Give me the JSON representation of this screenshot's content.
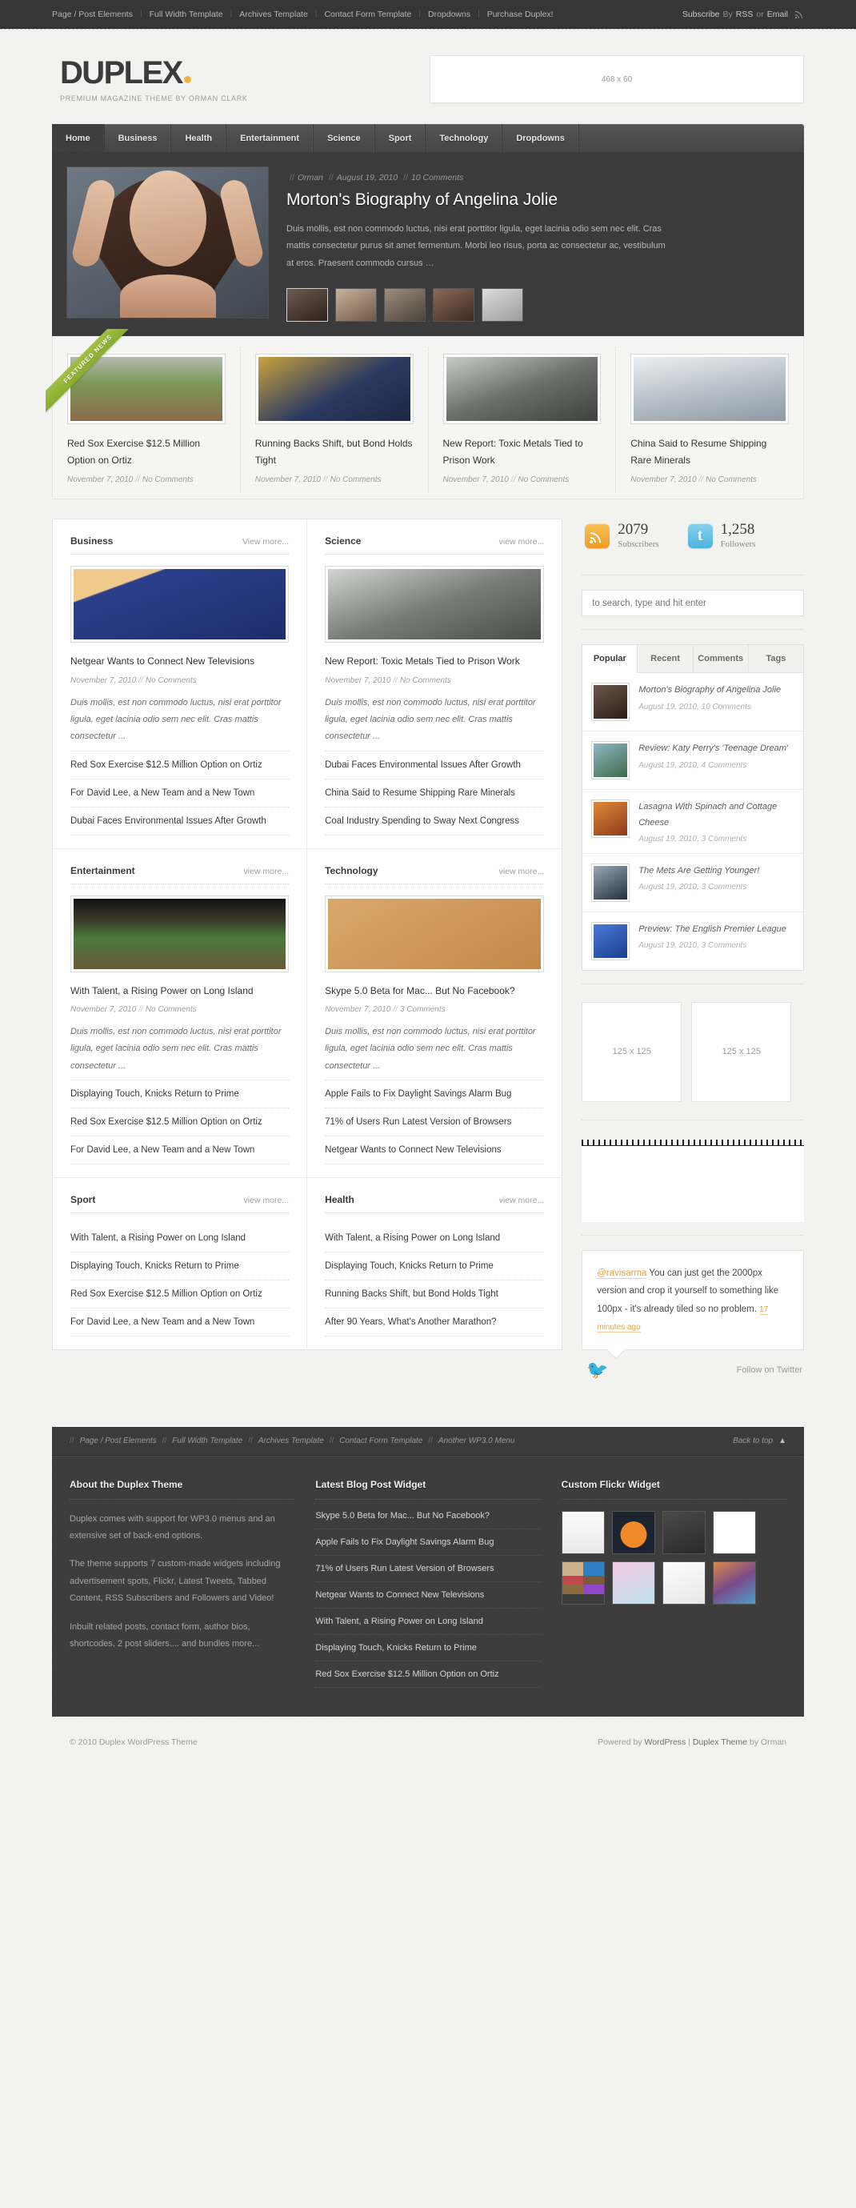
{
  "topbar": {
    "links": [
      "Page / Post Elements",
      "Full Width Template",
      "Archives Template",
      "Contact Form Template",
      "Dropdowns",
      "Purchase Duplex!"
    ],
    "subscribe_prefix": "Subscribe",
    "subscribe_by": "By",
    "rss_label": "RSS",
    "or": "or",
    "email_label": "Email"
  },
  "header": {
    "logo": "DUPLEX",
    "tagline": "PREMIUM MAGAZINE THEME BY ORMAN CLARK",
    "ad_label": "468 x 60"
  },
  "mainnav": {
    "items": [
      {
        "label": "Home",
        "active": true
      },
      {
        "label": "Business",
        "active": false
      },
      {
        "label": "Health",
        "active": false
      },
      {
        "label": "Entertainment",
        "active": false
      },
      {
        "label": "Science",
        "active": false
      },
      {
        "label": "Sport",
        "active": false
      },
      {
        "label": "Technology",
        "active": false
      },
      {
        "label": "Dropdowns",
        "active": false
      }
    ]
  },
  "slider": {
    "author": "Orman",
    "date": "August 19, 2010",
    "comments": "10 Comments",
    "title": "Morton's Biography of Angelina Jolie",
    "excerpt": "Duis mollis, est non commodo luctus, nisi erat porttitor ligula, eget lacinia odio sem nec elit. Cras mattis consectetur purus sit amet fermentum. Morbi leo risus, porta ac consectetur ac, vestibulum at eros. Praesent commodo cursus …",
    "thumb_count": 5
  },
  "featured": {
    "ribbon": "FEATURED NEWS",
    "items": [
      {
        "title": "Red Sox Exercise $12.5 Million Option on Ortiz",
        "date": "November 7, 2010",
        "comments": "No Comments",
        "img": "baseball"
      },
      {
        "title": "Running Backs Shift, but Bond Holds Tight",
        "date": "November 7, 2010",
        "comments": "No Comments",
        "img": "football"
      },
      {
        "title": "New Report: Toxic Metals Tied to Prison Work",
        "date": "November 7, 2010",
        "comments": "No Comments",
        "img": "scrap"
      },
      {
        "title": "China Said to Resume Shipping Rare Minerals",
        "date": "November 7, 2010",
        "comments": "No Comments",
        "img": "boxes"
      }
    ]
  },
  "blocks": [
    {
      "title": "Business",
      "more": "View more...",
      "img": "netgear",
      "post_title": "Netgear Wants to Connect New Televisions",
      "post_date": "November 7, 2010",
      "post_comments": "No Comments",
      "excerpt": "Duis mollis, est non commodo luctus, nisi erat porttitor ligula, eget lacinia odio sem nec elit. Cras mattis consectetur ...",
      "links": [
        "Red Sox Exercise $12.5 Million Option on Ortiz",
        "For David Lee, a New Team and a New Town",
        "Dubai Faces Environmental Issues After Growth"
      ]
    },
    {
      "title": "Science",
      "more": "view more...",
      "img": "scrap2",
      "post_title": "New Report: Toxic Metals Tied to Prison Work",
      "post_date": "November 7, 2010",
      "post_comments": "No Comments",
      "excerpt": "Duis mollis, est non commodo luctus, nisi erat porttitor ligula, eget lacinia odio sem nec elit. Cras mattis consectetur ...",
      "links": [
        "Dubai Faces Environmental Issues After Growth",
        "China Said to Resume Shipping Rare Minerals",
        "Coal Industry Spending to Sway Next Congress"
      ]
    },
    {
      "title": "Entertainment",
      "more": "view more...",
      "img": "stadium",
      "post_title": "With Talent, a Rising Power on Long Island",
      "post_date": "November 7, 2010",
      "post_comments": "No Comments",
      "excerpt": "Duis mollis, est non commodo luctus, nisi erat porttitor ligula, eget lacinia odio sem nec elit. Cras mattis consectetur ...",
      "links": [
        "Displaying Touch, Knicks Return to Prime",
        "Red Sox Exercise $12.5 Million Option on Ortiz",
        "For David Lee, a New Team and a New Town"
      ]
    },
    {
      "title": "Technology",
      "more": "view more...",
      "img": "phone",
      "post_title": "Skype 5.0 Beta for Mac... But No Facebook?",
      "post_date": "November 7, 2010",
      "post_comments": "3 Comments",
      "excerpt": "Duis mollis, est non commodo luctus, nisi erat porttitor ligula, eget lacinia odio sem nec elit. Cras mattis consectetur ...",
      "links": [
        "Apple Fails to Fix Daylight Savings Alarm Bug",
        "71% of Users Run Latest Version of Browsers",
        "Netgear Wants to Connect New Televisions"
      ]
    },
    {
      "title": "Sport",
      "more": "view more...",
      "links": [
        "With Talent, a Rising Power on Long Island",
        "Displaying Touch, Knicks Return to Prime",
        "Red Sox Exercise $12.5 Million Option on Ortiz",
        "For David Lee, a New Team and a New Town"
      ]
    },
    {
      "title": "Health",
      "more": "view more...",
      "links": [
        "With Talent, a Rising Power on Long Island",
        "Displaying Touch, Knicks Return to Prime",
        "Running Backs Shift, but Bond Holds Tight",
        "After 90 Years, What's Another Marathon?"
      ]
    }
  ],
  "sidebar": {
    "rss_count": "2079",
    "rss_label": "Subscribers",
    "twitter_count": "1,258",
    "twitter_label": "Followers",
    "twitter_glyph": "t",
    "search_placeholder": "to search, type and hit enter",
    "tabs": [
      "Popular",
      "Recent",
      "Comments",
      "Tags"
    ],
    "active_tab": "Popular",
    "popular": [
      {
        "title": "Morton's Biography of Angelina Jolie",
        "meta": "August 19, 2010, 10 Comments",
        "img": "jolie"
      },
      {
        "title": "Review: Katy Perry's 'Teenage Dream'",
        "meta": "August 19, 2010, 4 Comments",
        "img": "katy"
      },
      {
        "title": "Lasagna With Spinach and Cottage Cheese",
        "meta": "August 19, 2010, 3 Comments",
        "img": "lasagna"
      },
      {
        "title": "The Mets Are Getting Younger!",
        "meta": "August 19, 2010, 3 Comments",
        "img": "mets"
      },
      {
        "title": "Preview: The English Premier League",
        "meta": "August 19, 2010, 3 Comments",
        "img": "epl"
      }
    ],
    "ads": [
      "125 x 125",
      "125 x 125"
    ],
    "tweet": {
      "handle": "@ravisarma",
      "text": " You can just get the 2000px version and crop it yourself to something like 100px - it's already tiled so no problem. ",
      "ago": "17 minutes ago",
      "follow": "Follow on Twitter"
    }
  },
  "footer": {
    "nav_links": [
      "Page / Post Elements",
      "Full Width Template",
      "Archives Template",
      "Contact Form Template",
      "Another WP3.0 Menu"
    ],
    "back_to_top": "Back to top",
    "about": {
      "title": "About the Duplex Theme",
      "p1": "Duplex comes with support for WP3.0 menus and an extensive set of back-end options.",
      "p2": "The theme supports 7 custom-made widgets including advertisement spots, Flickr, Latest Tweets, Tabbed Content, RSS Subscribers and Followers and Video!",
      "p3": "Inbuilt related posts, contact form, author bios, shortcodes, 2 post sliders.... and bundles more..."
    },
    "latest": {
      "title": "Latest Blog Post Widget",
      "items": [
        "Skype 5.0 Beta for Mac... But No Facebook?",
        "Apple Fails to Fix Daylight Savings Alarm Bug",
        "71% of Users Run Latest Version of Browsers",
        "Netgear Wants to Connect New Televisions",
        "With Talent, a Rising Power on Long Island",
        "Displaying Touch, Knicks Return to Prime",
        "Red Sox Exercise $12.5 Million Option on Ortiz"
      ]
    },
    "flickr": {
      "title": "Custom Flickr Widget",
      "count": 8
    },
    "copyright": "© 2010 Duplex WordPress Theme",
    "powered_prefix": "Powered by",
    "powered_wp": "WordPress",
    "powered_sep": "|",
    "powered_theme": "Duplex Theme",
    "powered_by": "by",
    "powered_author": "Orman"
  }
}
